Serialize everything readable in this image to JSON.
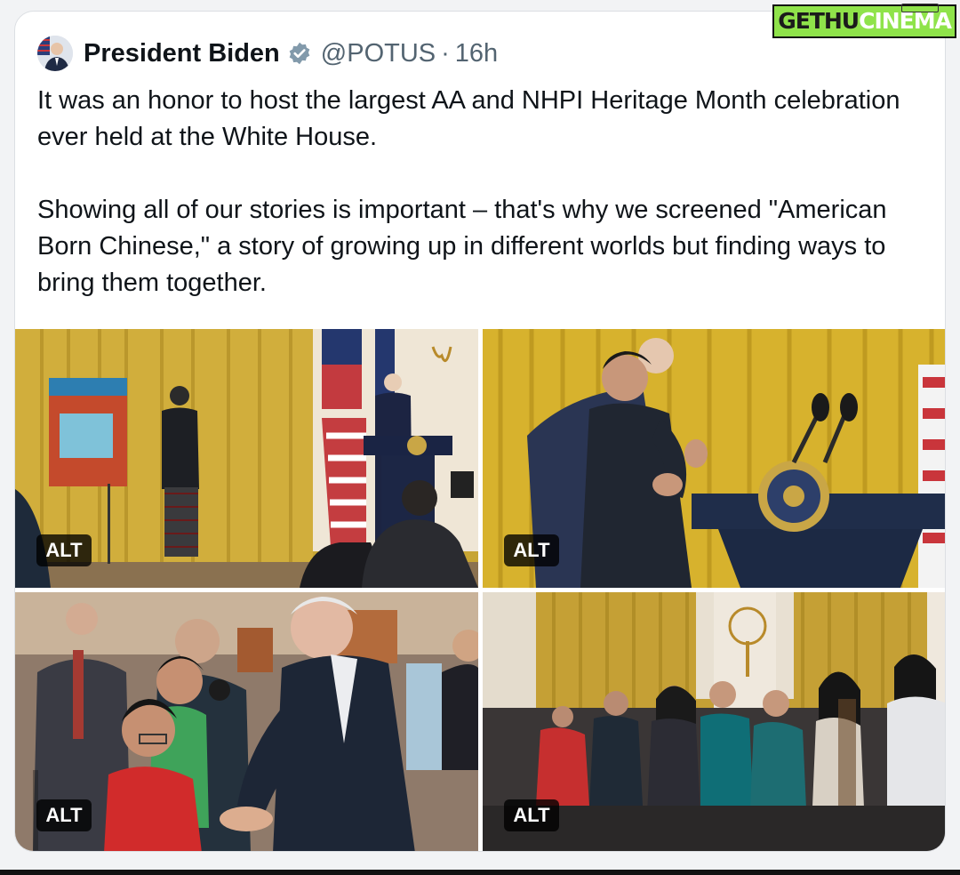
{
  "tweet": {
    "author_name": "President Biden",
    "handle": "@POTUS",
    "separator": "·",
    "time": "16h",
    "text_paragraphs": [
      "It was an honor to host the largest AA and NHPI Heritage Month celebration ever held at the White House.",
      "Showing all of our stories is important – that's why we screened \"American Born Chinese,\" a story of growing up in different worlds but finding ways to bring them together."
    ],
    "verified_icon": "verified-badge-icon",
    "photos": [
      {
        "alt_label": "ALT"
      },
      {
        "alt_label": "ALT"
      },
      {
        "alt_label": "ALT"
      },
      {
        "alt_label": "ALT"
      }
    ]
  },
  "watermark": {
    "part1": "GETHU",
    "part2": "CINEMA"
  },
  "colors": {
    "text_primary": "#0f1419",
    "text_secondary": "#536471",
    "verified": "#829aab",
    "curtain_gold": "#caa830",
    "watermark_green": "#8fe34a"
  }
}
